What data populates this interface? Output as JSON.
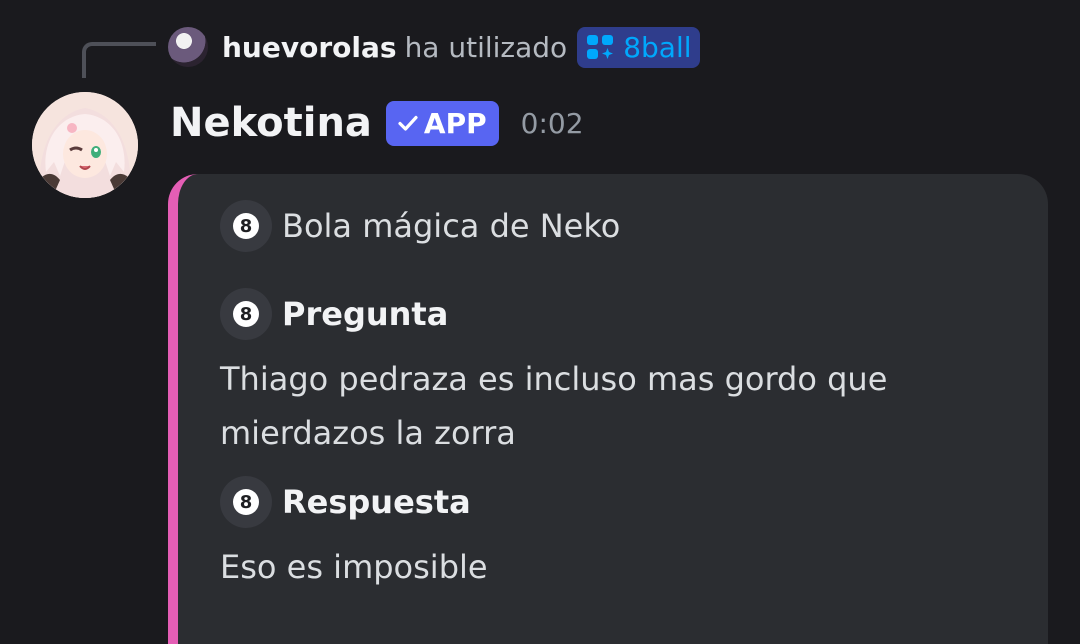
{
  "reply": {
    "username": "huevorolas",
    "action_text": "ha utilizado",
    "command": "8ball",
    "command_icon": "app-command-icon"
  },
  "message": {
    "bot_name": "Nekotina",
    "badge_label": "APP",
    "badge_icon": "checkmark-icon",
    "timestamp": "0:02"
  },
  "embed": {
    "accent_color": "#e45eb5",
    "author": "Bola mágica de Neko",
    "fields": [
      {
        "name": "Pregunta",
        "value": "Thiago pedraza es incluso mas gordo que mierdazos la zorra"
      },
      {
        "name": "Respuesta",
        "value": "Eso es imposible"
      }
    ]
  },
  "colors": {
    "background": "#1a1a1e",
    "embed_background": "#2b2d31",
    "badge": "#5865f2",
    "command_link": "#00a8fc"
  }
}
